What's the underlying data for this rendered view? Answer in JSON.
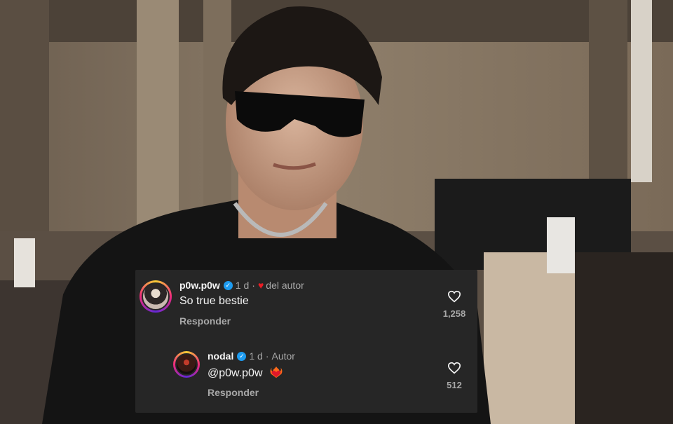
{
  "background": {
    "description_colors": {
      "wall": "#8c7b67",
      "shadow": "#3b342d",
      "jacket": "#141414"
    }
  },
  "comments": [
    {
      "username": "p0w.p0w",
      "verified": true,
      "time": "1 d",
      "separator": "·",
      "author_like_label": "del autor",
      "text": "So true bestie",
      "reply_label": "Responder",
      "like_count": "1,258"
    },
    {
      "username": "nodal",
      "verified": true,
      "time": "1 d",
      "separator": "·",
      "author_label": "Autor",
      "text": "@p0w.p0w",
      "emoji": "heart-on-fire-icon",
      "reply_label": "Responder",
      "like_count": "512"
    }
  ],
  "colors": {
    "card_bg": "#262626",
    "text_primary": "#f5f5f5",
    "text_muted": "#a8a8a8",
    "verified_blue": "#1d9bf0",
    "heart_red": "#ed1c24"
  }
}
